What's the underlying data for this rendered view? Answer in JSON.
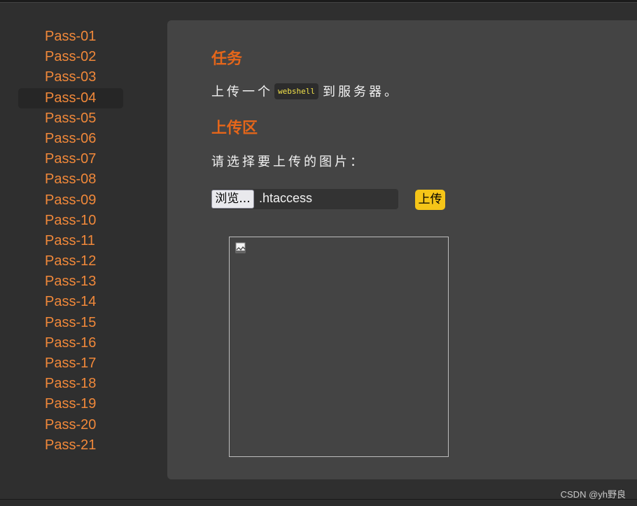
{
  "sidebar": {
    "items": [
      {
        "label": "Pass-01"
      },
      {
        "label": "Pass-02"
      },
      {
        "label": "Pass-03"
      },
      {
        "label": "Pass-04"
      },
      {
        "label": "Pass-05"
      },
      {
        "label": "Pass-06"
      },
      {
        "label": "Pass-07"
      },
      {
        "label": "Pass-08"
      },
      {
        "label": "Pass-09"
      },
      {
        "label": "Pass-10"
      },
      {
        "label": "Pass-11"
      },
      {
        "label": "Pass-12"
      },
      {
        "label": "Pass-13"
      },
      {
        "label": "Pass-14"
      },
      {
        "label": "Pass-15"
      },
      {
        "label": "Pass-16"
      },
      {
        "label": "Pass-17"
      },
      {
        "label": "Pass-18"
      },
      {
        "label": "Pass-19"
      },
      {
        "label": "Pass-20"
      },
      {
        "label": "Pass-21"
      }
    ],
    "active_label": "Pass-04"
  },
  "main": {
    "task_title": "任务",
    "task_prefix": "上传一个",
    "task_code": "webshell",
    "task_suffix": "到服务器。",
    "upload_title": "上传区",
    "upload_prompt": "请选择要上传的图片：",
    "browse_label": "浏览...",
    "file_value": ".htaccess",
    "upload_button": "上传",
    "preview_icon": "broken-image-icon"
  },
  "watermark": "CSDN @yh野良",
  "colors": {
    "accent": "#e5661a",
    "link": "#f0883a",
    "button": "#f5c518",
    "code_text": "#f2e24a"
  }
}
